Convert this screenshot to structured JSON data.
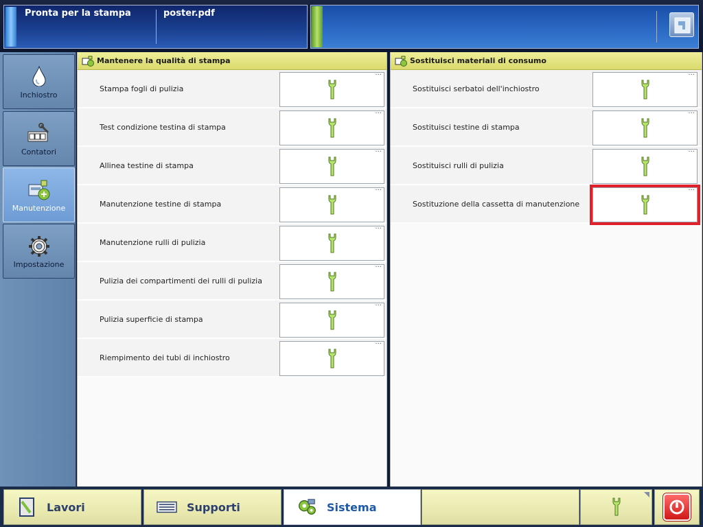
{
  "topbar": {
    "status": "Pronta per la stampa",
    "file": "poster.pdf",
    "progress": 0
  },
  "sidebar": {
    "items": [
      {
        "label": "Inchiostro",
        "icon": "ink-drop-icon",
        "active": false
      },
      {
        "label": "Contatori",
        "icon": "counters-icon",
        "active": false
      },
      {
        "label": "Manutenzione",
        "icon": "maintenance-icon",
        "active": true
      },
      {
        "label": "Impostazione",
        "icon": "gear-icon",
        "active": false
      }
    ]
  },
  "left_pane": {
    "title": "Mantenere la qualità di stampa",
    "rows": [
      {
        "label": "Stampa fogli di pulizia"
      },
      {
        "label": "Test condizione testina di stampa"
      },
      {
        "label": "Allinea testine di stampa"
      },
      {
        "label": "Manutenzione testine di stampa"
      },
      {
        "label": "Manutenzione rulli di pulizia"
      },
      {
        "label": "Pulizia dei compartimenti dei rulli di pulizia"
      },
      {
        "label": "Pulizia superficie di stampa"
      },
      {
        "label": "Riempimento dei tubi di inchiostro"
      }
    ]
  },
  "right_pane": {
    "title": "Sostituisci materiali di consumo",
    "rows": [
      {
        "label": "Sostituisci serbatoi dell'inchiostro"
      },
      {
        "label": "Sostituisci testine di stampa"
      },
      {
        "label": "Sostituisci rulli di pulizia"
      },
      {
        "label": "Sostituzione della cassetta di manutenzione",
        "highlighted": true
      }
    ]
  },
  "common": {
    "more_dots": "...",
    "action_icon": "wrench-icon"
  },
  "taskbar": {
    "lavori": "Lavori",
    "supporti": "Supporti",
    "sistema": "Sistema"
  },
  "colors": {
    "header_yellow": "#dada6c",
    "highlight_red": "#e0202a",
    "wrench_green": "#7fbf3f",
    "active_tab_text": "#1e5aa8"
  }
}
